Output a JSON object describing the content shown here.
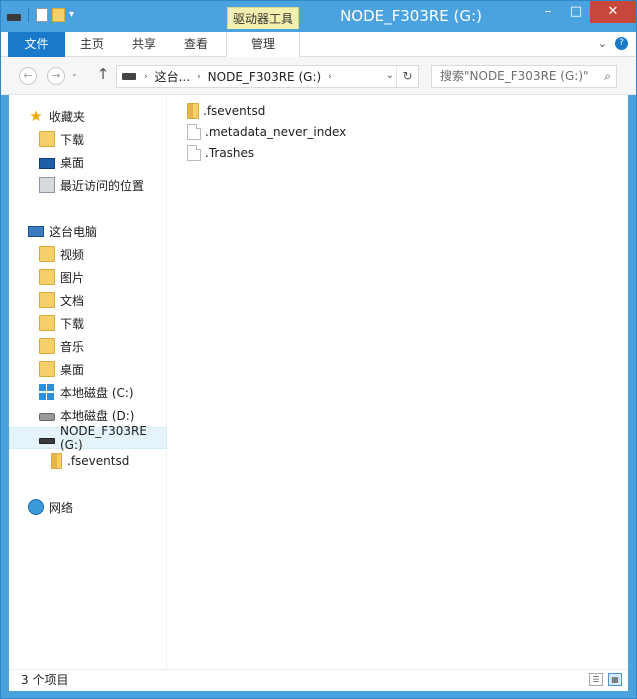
{
  "window": {
    "title": "NODE_F303RE (G:)",
    "controls": {
      "minimize": "–",
      "maximize": "□",
      "close": "✕"
    }
  },
  "ribbon": {
    "context_tab_group": "驱动器工具",
    "tabs": [
      "文件",
      "主页",
      "共享",
      "查看",
      "管理"
    ],
    "right_icons": [
      "chevron-down-icon",
      "help-icon"
    ]
  },
  "address": {
    "back": "←",
    "forward": "→",
    "up": "↑",
    "crumbs": [
      "这台...",
      "NODE_F303RE (G:)"
    ],
    "search_placeholder": "搜索\"NODE_F303RE (G:)\""
  },
  "nav": {
    "favorites_label": "收藏夹",
    "favorites": [
      "下载",
      "桌面",
      "最近访问的位置"
    ],
    "pc_label": "这台电脑",
    "pc_items": [
      "视频",
      "图片",
      "文档",
      "下载",
      "音乐",
      "桌面",
      "本地磁盘 (C:)",
      "本地磁盘 (D:)",
      "NODE_F303RE (G:)",
      ".fseventsd"
    ],
    "network_label": "网络"
  },
  "files": [
    {
      "name": ".fseventsd",
      "icon": "folder-icon"
    },
    {
      "name": ".metadata_never_index",
      "icon": "file-icon"
    },
    {
      "name": ".Trashes",
      "icon": "file-icon"
    }
  ],
  "status": {
    "count_text": "3 个项目"
  },
  "colors": {
    "accent": "#1979ca",
    "title_bar": "#4aa3df",
    "close_button": "#c7483b",
    "context_tab": "#f4f0b0"
  }
}
